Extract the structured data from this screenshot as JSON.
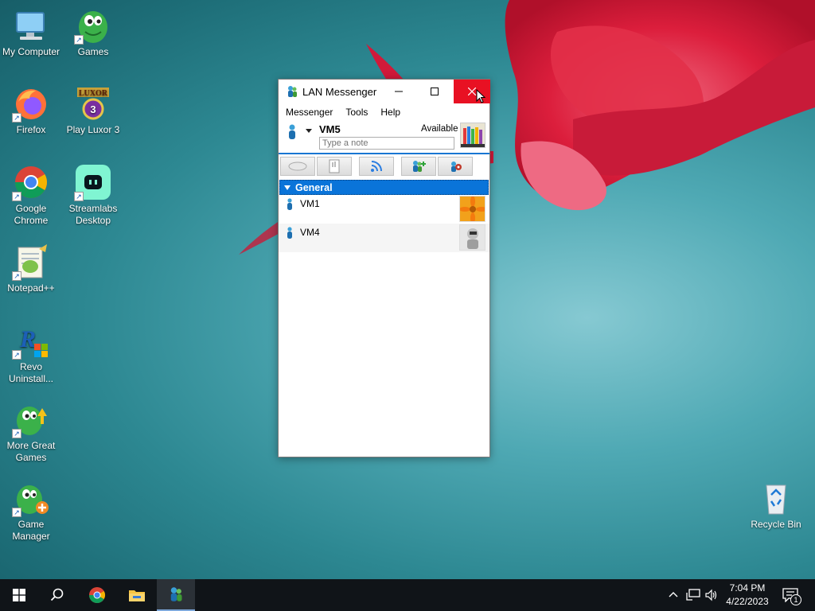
{
  "desktop": {
    "icons": [
      {
        "label": "My Computer",
        "icon": "computer-icon"
      },
      {
        "label": "Games",
        "icon": "games-icon"
      },
      {
        "label": "Firefox",
        "icon": "firefox-icon"
      },
      {
        "label": "Play Luxor 3",
        "icon": "luxor-icon"
      },
      {
        "label": "Google Chrome",
        "icon": "chrome-icon"
      },
      {
        "label": "Streamlabs Desktop",
        "icon": "streamlabs-icon"
      },
      {
        "label": "Notepad++",
        "icon": "notepadpp-icon"
      },
      {
        "label": "Revo Uninstall...",
        "icon": "revo-icon"
      },
      {
        "label": "More Great Games",
        "icon": "more-games-icon"
      },
      {
        "label": "Game Manager",
        "icon": "game-manager-icon"
      },
      {
        "label": "Recycle Bin",
        "icon": "recycle-bin-icon"
      }
    ]
  },
  "window": {
    "title": "LAN Messenger",
    "controls": {
      "minimize": "minimize-icon",
      "maximize": "maximize-icon",
      "close": "close-icon"
    },
    "menu": [
      "Messenger",
      "Tools",
      "Help"
    ],
    "user": {
      "name": "VM5",
      "status": "Available",
      "note_placeholder": "Type a note"
    },
    "toolbar": [
      "chat-icon",
      "file-icon",
      "broadcast-icon",
      "add-contact-icon",
      "settings-icon"
    ],
    "groups": [
      {
        "name": "General",
        "contacts": [
          {
            "name": "VM1",
            "avatar": "flower-avatar"
          },
          {
            "name": "VM4",
            "avatar": "robot-avatar"
          }
        ]
      }
    ]
  },
  "taskbar": {
    "items": [
      "start-icon",
      "search-icon",
      "chrome-icon",
      "file-explorer-icon",
      "lan-messenger-icon"
    ],
    "time": "7:04 PM",
    "date": "4/22/2023",
    "notifications": "1"
  },
  "colors": {
    "accent": "#0a74d9",
    "close_hover": "#e81123",
    "taskbar": "#101418"
  }
}
